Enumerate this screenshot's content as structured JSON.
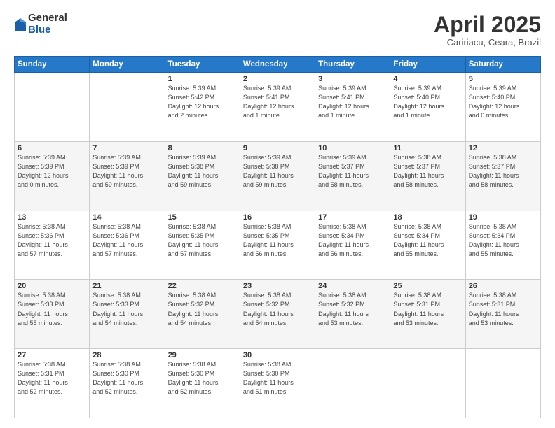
{
  "header": {
    "logo_general": "General",
    "logo_blue": "Blue",
    "month_year": "April 2025",
    "location": "Caririacu, Ceara, Brazil"
  },
  "days_of_week": [
    "Sunday",
    "Monday",
    "Tuesday",
    "Wednesday",
    "Thursday",
    "Friday",
    "Saturday"
  ],
  "weeks": [
    [
      {
        "day": "",
        "info": ""
      },
      {
        "day": "",
        "info": ""
      },
      {
        "day": "1",
        "info": "Sunrise: 5:39 AM\nSunset: 5:42 PM\nDaylight: 12 hours\nand 2 minutes."
      },
      {
        "day": "2",
        "info": "Sunrise: 5:39 AM\nSunset: 5:41 PM\nDaylight: 12 hours\nand 1 minute."
      },
      {
        "day": "3",
        "info": "Sunrise: 5:39 AM\nSunset: 5:41 PM\nDaylight: 12 hours\nand 1 minute."
      },
      {
        "day": "4",
        "info": "Sunrise: 5:39 AM\nSunset: 5:40 PM\nDaylight: 12 hours\nand 1 minute."
      },
      {
        "day": "5",
        "info": "Sunrise: 5:39 AM\nSunset: 5:40 PM\nDaylight: 12 hours\nand 0 minutes."
      }
    ],
    [
      {
        "day": "6",
        "info": "Sunrise: 5:39 AM\nSunset: 5:39 PM\nDaylight: 12 hours\nand 0 minutes."
      },
      {
        "day": "7",
        "info": "Sunrise: 5:39 AM\nSunset: 5:39 PM\nDaylight: 11 hours\nand 59 minutes."
      },
      {
        "day": "8",
        "info": "Sunrise: 5:39 AM\nSunset: 5:38 PM\nDaylight: 11 hours\nand 59 minutes."
      },
      {
        "day": "9",
        "info": "Sunrise: 5:39 AM\nSunset: 5:38 PM\nDaylight: 11 hours\nand 59 minutes."
      },
      {
        "day": "10",
        "info": "Sunrise: 5:39 AM\nSunset: 5:37 PM\nDaylight: 11 hours\nand 58 minutes."
      },
      {
        "day": "11",
        "info": "Sunrise: 5:38 AM\nSunset: 5:37 PM\nDaylight: 11 hours\nand 58 minutes."
      },
      {
        "day": "12",
        "info": "Sunrise: 5:38 AM\nSunset: 5:37 PM\nDaylight: 11 hours\nand 58 minutes."
      }
    ],
    [
      {
        "day": "13",
        "info": "Sunrise: 5:38 AM\nSunset: 5:36 PM\nDaylight: 11 hours\nand 57 minutes."
      },
      {
        "day": "14",
        "info": "Sunrise: 5:38 AM\nSunset: 5:36 PM\nDaylight: 11 hours\nand 57 minutes."
      },
      {
        "day": "15",
        "info": "Sunrise: 5:38 AM\nSunset: 5:35 PM\nDaylight: 11 hours\nand 57 minutes."
      },
      {
        "day": "16",
        "info": "Sunrise: 5:38 AM\nSunset: 5:35 PM\nDaylight: 11 hours\nand 56 minutes."
      },
      {
        "day": "17",
        "info": "Sunrise: 5:38 AM\nSunset: 5:34 PM\nDaylight: 11 hours\nand 56 minutes."
      },
      {
        "day": "18",
        "info": "Sunrise: 5:38 AM\nSunset: 5:34 PM\nDaylight: 11 hours\nand 55 minutes."
      },
      {
        "day": "19",
        "info": "Sunrise: 5:38 AM\nSunset: 5:34 PM\nDaylight: 11 hours\nand 55 minutes."
      }
    ],
    [
      {
        "day": "20",
        "info": "Sunrise: 5:38 AM\nSunset: 5:33 PM\nDaylight: 11 hours\nand 55 minutes."
      },
      {
        "day": "21",
        "info": "Sunrise: 5:38 AM\nSunset: 5:33 PM\nDaylight: 11 hours\nand 54 minutes."
      },
      {
        "day": "22",
        "info": "Sunrise: 5:38 AM\nSunset: 5:32 PM\nDaylight: 11 hours\nand 54 minutes."
      },
      {
        "day": "23",
        "info": "Sunrise: 5:38 AM\nSunset: 5:32 PM\nDaylight: 11 hours\nand 54 minutes."
      },
      {
        "day": "24",
        "info": "Sunrise: 5:38 AM\nSunset: 5:32 PM\nDaylight: 11 hours\nand 53 minutes."
      },
      {
        "day": "25",
        "info": "Sunrise: 5:38 AM\nSunset: 5:31 PM\nDaylight: 11 hours\nand 53 minutes."
      },
      {
        "day": "26",
        "info": "Sunrise: 5:38 AM\nSunset: 5:31 PM\nDaylight: 11 hours\nand 53 minutes."
      }
    ],
    [
      {
        "day": "27",
        "info": "Sunrise: 5:38 AM\nSunset: 5:31 PM\nDaylight: 11 hours\nand 52 minutes."
      },
      {
        "day": "28",
        "info": "Sunrise: 5:38 AM\nSunset: 5:30 PM\nDaylight: 11 hours\nand 52 minutes."
      },
      {
        "day": "29",
        "info": "Sunrise: 5:38 AM\nSunset: 5:30 PM\nDaylight: 11 hours\nand 52 minutes."
      },
      {
        "day": "30",
        "info": "Sunrise: 5:38 AM\nSunset: 5:30 PM\nDaylight: 11 hours\nand 51 minutes."
      },
      {
        "day": "",
        "info": ""
      },
      {
        "day": "",
        "info": ""
      },
      {
        "day": "",
        "info": ""
      }
    ]
  ]
}
